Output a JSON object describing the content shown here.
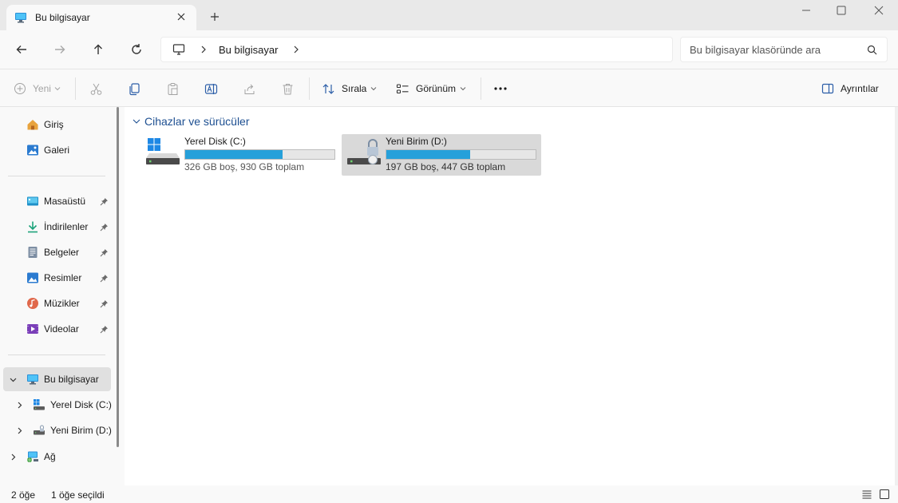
{
  "window": {
    "tab_title": "Bu bilgisayar",
    "icons": {
      "tab": "computer-icon",
      "close_tab": "close-icon",
      "new_tab": "plus-icon",
      "minimize": "minimize-icon",
      "maximize": "maximize-icon",
      "close": "close-icon"
    }
  },
  "address": {
    "breadcrumb": "Bu bilgisayar",
    "search_placeholder": "Bu bilgisayar klasöründe ara"
  },
  "toolbar": {
    "new_label": "Yeni",
    "sort_label": "Sırala",
    "view_label": "Görünüm",
    "details_label": "Ayrıntılar",
    "disabled_color": "#a3a3a3"
  },
  "sidebar": {
    "top": [
      {
        "label": "Giriş",
        "icon": "home-icon"
      },
      {
        "label": "Galeri",
        "icon": "gallery-icon"
      }
    ],
    "pinned": [
      {
        "label": "Masaüstü",
        "icon": "desktop-icon"
      },
      {
        "label": "İndirilenler",
        "icon": "download-icon"
      },
      {
        "label": "Belgeler",
        "icon": "documents-icon"
      },
      {
        "label": "Resimler",
        "icon": "pictures-icon"
      },
      {
        "label": "Müzikler",
        "icon": "music-icon"
      },
      {
        "label": "Videolar",
        "icon": "videos-icon"
      }
    ],
    "tree": [
      {
        "label": "Bu bilgisayar",
        "icon": "computer-icon",
        "selected": true,
        "expanded": true
      },
      {
        "label": "Yerel Disk (C:)",
        "icon": "windows-drive-icon"
      },
      {
        "label": "Yeni Birim (D:)",
        "icon": "locked-drive-icon"
      },
      {
        "label": "Ağ",
        "icon": "network-icon"
      }
    ]
  },
  "main": {
    "group_title": "Cihazlar ve sürücüler",
    "drives": [
      {
        "name": "Yerel Disk (C:)",
        "info": "326 GB boş, 930 GB toplam",
        "used_fraction": 0.65,
        "selected": false
      },
      {
        "name": "Yeni Birim (D:)",
        "info": "197 GB boş, 447 GB toplam",
        "used_fraction": 0.56,
        "selected": true
      }
    ],
    "accent_color": "#26a0da",
    "header_color": "#1d4f91"
  },
  "status": {
    "item_count": "2 öğe",
    "selected_count": "1 öğe seçildi"
  }
}
